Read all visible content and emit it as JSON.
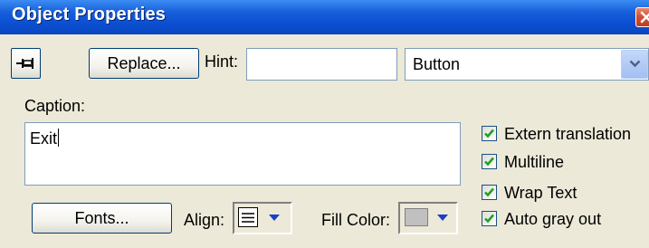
{
  "window": {
    "title": "Object Properties"
  },
  "toolbar": {
    "replace_label": "Replace...",
    "hint_label": "Hint:",
    "hint_value": "",
    "type_value": "Button"
  },
  "caption": {
    "label": "Caption:",
    "value": "Exit"
  },
  "options": {
    "items": [
      {
        "label": "Extern translation",
        "checked": true
      },
      {
        "label": "Multiline",
        "checked": true
      },
      {
        "label": "Wrap Text",
        "checked": true
      },
      {
        "label": "Auto gray out",
        "checked": true
      }
    ]
  },
  "bottom": {
    "fonts_label": "Fonts...",
    "align_label": "Align:",
    "align_value": "left",
    "fill_label": "Fill Color:",
    "fill_color": "#c0c0c0"
  },
  "colors": {
    "accent": "#0b4fd2",
    "checkmark": "#21a121",
    "dropdown_arrow": "#1a40c8"
  },
  "icons": {
    "pin": "pin-icon",
    "close": "close-icon",
    "dropdown": "chevron-down-icon",
    "align": "align-left-icon"
  }
}
